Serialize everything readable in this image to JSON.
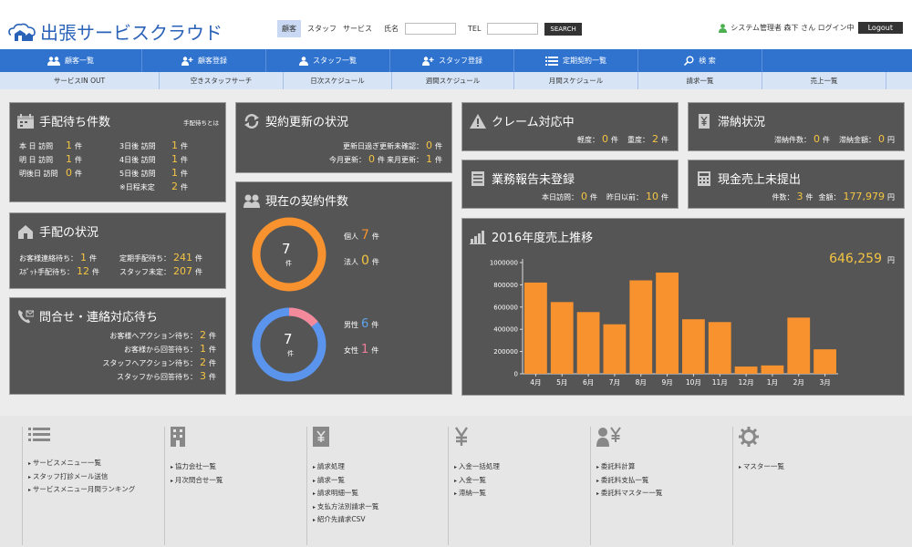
{
  "header": {
    "logo_text": "出張サービスクラウド",
    "tabs": [
      "顧客",
      "スタッフ",
      "サービス"
    ],
    "name_label": "氏名",
    "tel_label": "TEL",
    "search_label": "SEARCH",
    "user_text": "システム管理者 森下 さん ログイン中",
    "logout_label": "Logout"
  },
  "nav1": [
    "顧客一覧",
    "顧客登録",
    "スタッフ一覧",
    "スタッフ登録",
    "定期契約一覧",
    "検 索"
  ],
  "nav2": [
    "サービスIN OUT",
    "空きスタッフサーチ",
    "日次スケジュール",
    "週間スケジュール",
    "月間スケジュール",
    "請求一覧",
    "売上一覧"
  ],
  "tehai_wait": {
    "title": "手配待ち件数",
    "link": "手配待ちとは",
    "left": [
      {
        "label": "本 日 訪問",
        "value": "1",
        "unit": "件"
      },
      {
        "label": "明 日 訪問",
        "value": "1",
        "unit": "件"
      },
      {
        "label": "明後日 訪問",
        "value": "0",
        "unit": "件"
      }
    ],
    "right": [
      {
        "label": "3日後 訪問",
        "value": "1",
        "unit": "件"
      },
      {
        "label": "4日後 訪問",
        "value": "1",
        "unit": "件"
      },
      {
        "label": "5日後 訪問",
        "value": "1",
        "unit": "件"
      },
      {
        "label": "※日程未定",
        "value": "2",
        "unit": "件"
      }
    ]
  },
  "tehai_status": {
    "title": "手配の状況",
    "rows": [
      {
        "label": "お客様連絡待ち：",
        "value": "1",
        "unit": "件"
      },
      {
        "label": "ｽﾎﾟｯﾄ手配待ち：",
        "value": "12",
        "unit": "件"
      },
      {
        "label": "定期手配待ち：",
        "value": "241",
        "unit": "件"
      },
      {
        "label": "スタッフ未定：",
        "value": "207",
        "unit": "件"
      }
    ]
  },
  "inquiry": {
    "title": "問合せ・連絡対応待ち",
    "rows": [
      {
        "label": "お客様へアクション待ち：",
        "value": "2",
        "unit": "件"
      },
      {
        "label": "お客様から回答待ち：",
        "value": "1",
        "unit": "件"
      },
      {
        "label": "スタッフへアクション待ち：",
        "value": "2",
        "unit": "件"
      },
      {
        "label": "スタッフから回答待ち：",
        "value": "3",
        "unit": "件"
      }
    ]
  },
  "renewal": {
    "title": "契約更新の状況",
    "row1_label": "更新日過ぎ更新未確認：",
    "row1_value": "0",
    "unit": "件",
    "row2_label_a": "今月更新：",
    "row2_value_a": "0",
    "row2_label_b": "来月更新：",
    "row2_value_b": "1"
  },
  "contracts": {
    "title": "現在の契約件数",
    "donut1_total": "7",
    "donut1_unit": "件",
    "individual_label": "個人",
    "individual_value": "7",
    "corporate_label": "法人",
    "corporate_value": "0",
    "donut2_total": "7",
    "donut2_unit": "件",
    "male_label": "男性",
    "male_value": "6",
    "female_label": "女性",
    "female_value": "1",
    "unit": "件",
    "colors": {
      "individual": "#f7922e",
      "male": "#5b94ec",
      "female": "#f28a9c"
    }
  },
  "claim": {
    "title": "クレーム対応中",
    "a_label": "軽度：",
    "a_value": "0",
    "b_label": "重度：",
    "b_value": "2",
    "unit": "件"
  },
  "report": {
    "title": "業務報告未登録",
    "a_label": "本日訪問：",
    "a_value": "0",
    "b_label": "昨日以前：",
    "b_value": "10",
    "unit": "件"
  },
  "arrears": {
    "title": "滞納状況",
    "a_label": "滞納件数：",
    "a_value": "0",
    "a_unit": "件",
    "b_label": "滞納金額：",
    "b_value": "0",
    "b_unit": "円"
  },
  "cash": {
    "title": "現金売上未提出",
    "a_label": "件数：",
    "a_value": "3",
    "a_unit": "件",
    "b_label": "金額：",
    "b_value": "177,979",
    "b_unit": "円"
  },
  "sales": {
    "title": "2016年度売上推移",
    "total": "646,259",
    "total_unit": "円"
  },
  "chart_data": {
    "type": "bar",
    "categories": [
      "4月",
      "5月",
      "6月",
      "7月",
      "8月",
      "9月",
      "10月",
      "11月",
      "12月",
      "1月",
      "2月",
      "3月"
    ],
    "values": [
      820000,
      645000,
      555000,
      445000,
      840000,
      910000,
      490000,
      465000,
      65000,
      75000,
      505000,
      220000
    ],
    "ylim": [
      0,
      1000000
    ],
    "yticks": [
      "0",
      "200000",
      "400000",
      "600000",
      "800000",
      "1000000"
    ],
    "color": "#f7922e"
  },
  "footer": {
    "cols": [
      {
        "items": [
          "サービスメニュー一覧",
          "スタッフ打診メール送信",
          "サービスメニュー月間ランキング"
        ]
      },
      {
        "items": [
          "協力会社一覧",
          "月次問合せ一覧"
        ]
      },
      {
        "items": [
          "請求処理",
          "請求一覧",
          "請求明細一覧",
          "支払方法別請求一覧",
          "紹介先請求CSV"
        ]
      },
      {
        "items": [
          "入金一括処理",
          "入金一覧",
          "滞納一覧"
        ]
      },
      {
        "items": [
          "委託料計算",
          "委託料支払一覧",
          "委託料マスター一覧"
        ]
      },
      {
        "items": [
          "マスター一覧"
        ]
      }
    ]
  }
}
